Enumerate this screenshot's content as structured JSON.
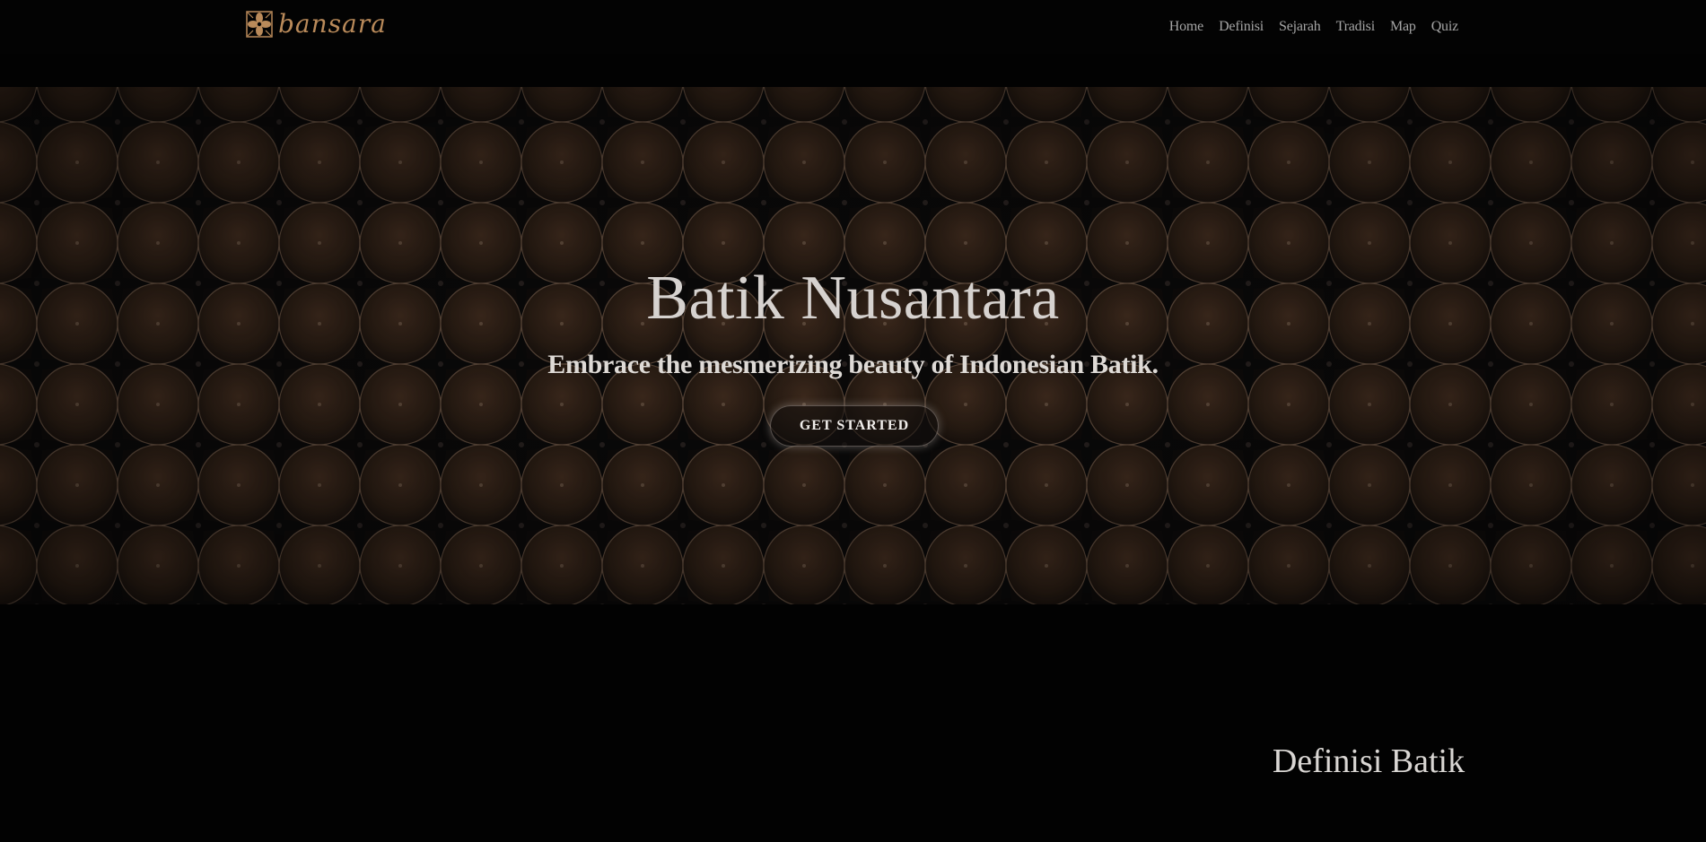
{
  "navbar": {
    "logo_text": "bansara",
    "links": [
      {
        "label": "Home"
      },
      {
        "label": "Definisi"
      },
      {
        "label": "Sejarah"
      },
      {
        "label": "Tradisi"
      },
      {
        "label": "Map"
      },
      {
        "label": "Quiz"
      }
    ]
  },
  "hero": {
    "title": "Batik Nusantara",
    "subtitle": "Embrace the mesmerizing beauty of Indonesian Batik.",
    "cta_label": "GET STARTED"
  },
  "definisi": {
    "title": "Definisi Batik"
  },
  "colors": {
    "background": "#020202",
    "logo_gold": "#b98a5a",
    "pattern_brown": "#3b281c",
    "nav_text": "#a5a5a5"
  },
  "icons": {
    "logo": "batik-kawung-logo-icon"
  }
}
